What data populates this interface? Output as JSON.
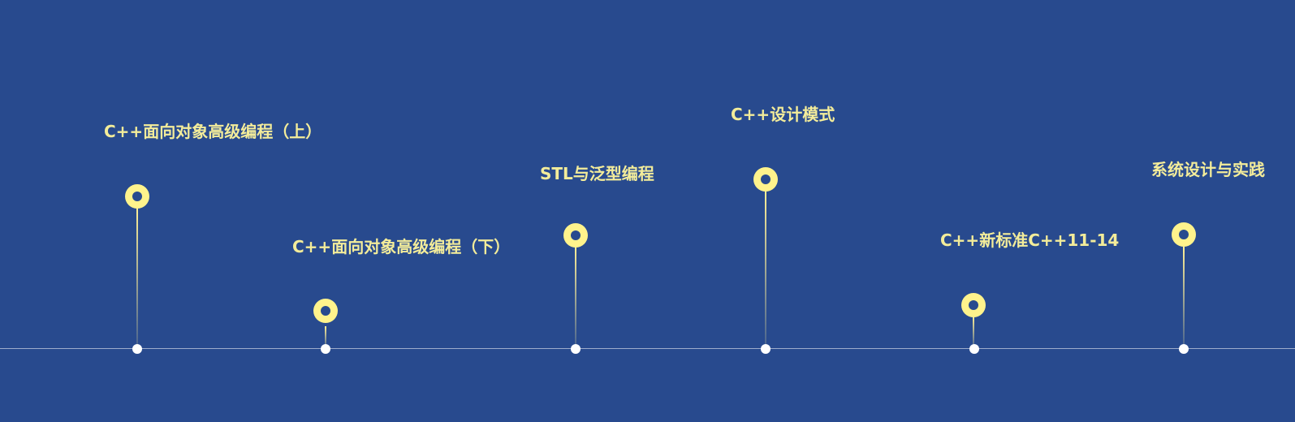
{
  "colors": {
    "background": "#284a8e",
    "pin": "#fff38c",
    "label": "#f3ec9a",
    "baseline": "#ffffff"
  },
  "milestones": [
    {
      "label": "C++面向对象高级编程（上）"
    },
    {
      "label": "C++面向对象高级编程（下）"
    },
    {
      "label": "STL与泛型编程"
    },
    {
      "label": "C++设计模式"
    },
    {
      "label": "C++新标准C++11-14"
    },
    {
      "label": "系统设计与实践"
    }
  ]
}
